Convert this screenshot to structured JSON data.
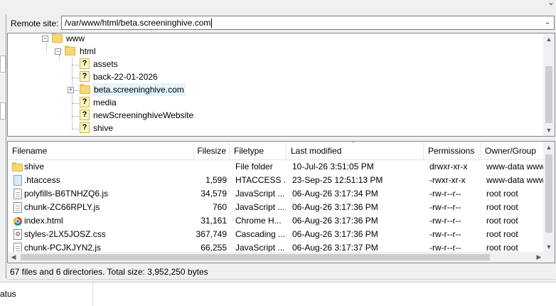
{
  "remote_site": {
    "label": "Remote site:",
    "path": "/var/www/html/beta.screeninghive.com"
  },
  "tree": {
    "nodes": [
      {
        "label": "www",
        "icon": "folder",
        "expander": "-"
      },
      {
        "label": "html",
        "icon": "folder",
        "expander": "-"
      },
      {
        "label": "assets",
        "icon": "unknown-folder"
      },
      {
        "label": "back-22-01-2026",
        "icon": "unknown-folder"
      },
      {
        "label": "beta.screeninghive.com",
        "icon": "folder",
        "expander": "+",
        "selected": true
      },
      {
        "label": "media",
        "icon": "unknown-folder"
      },
      {
        "label": "newScreeninghiveWebsite",
        "icon": "unknown-folder"
      },
      {
        "label": "shive",
        "icon": "unknown-folder"
      }
    ],
    "unknown_glyph": "?"
  },
  "file_list": {
    "headers": {
      "filename": "Filename",
      "filesize": "Filesize",
      "filetype": "Filetype",
      "last_modified": "Last modified",
      "permissions": "Permissions",
      "owner_group": "Owner/Group"
    },
    "rows": [
      {
        "name": "shive",
        "icon": "folder-icon",
        "size": "",
        "type": "File folder",
        "modified": "10-Jul-26 3:51:05 PM",
        "perms": "drwxr-xr-x",
        "owner": "www-data www-data"
      },
      {
        "name": ".htaccess",
        "icon": "htaccess-file-icon",
        "size": "1,599",
        "type": "HTACCESS ...",
        "modified": "23-Sep-25 12:51:13 PM",
        "perms": "-rwxr-xr-x",
        "owner": "www-data www-data"
      },
      {
        "name": "polyfills-B6TNHZQ6.js",
        "icon": "js-file-icon",
        "size": "34,579",
        "type": "JavaScript ...",
        "modified": "06-Aug-26 3:17:34 PM",
        "perms": "-rw-r--r--",
        "owner": "root root"
      },
      {
        "name": "chunk-ZC66RPLY.js",
        "icon": "js-file-icon",
        "size": "760",
        "type": "JavaScript ...",
        "modified": "06-Aug-26 3:17:36 PM",
        "perms": "-rw-r--r--",
        "owner": "root root"
      },
      {
        "name": "index.html",
        "icon": "chrome-html-icon",
        "size": "31,161",
        "type": "Chrome H...",
        "modified": "06-Aug-26 3:17:36 PM",
        "perms": "-rw-r--r--",
        "owner": "root root"
      },
      {
        "name": "styles-2LX5JOSZ.css",
        "icon": "css-file-icon",
        "size": "367,749",
        "type": "Cascading ...",
        "modified": "06-Aug-26 3:17:36 PM",
        "perms": "-rw-r--r--",
        "owner": "root root"
      },
      {
        "name": "chunk-PCJKJYN2.js",
        "icon": "js-file-icon",
        "size": "66,255",
        "type": "JavaScript ...",
        "modified": "06-Aug-26 3:17:37 PM",
        "perms": "-rw-r--r--",
        "owner": "root root"
      }
    ]
  },
  "status": {
    "summary": "67 files and 6 directories. Total size: 3,952,250 bytes",
    "bottom_tab": "atus"
  }
}
